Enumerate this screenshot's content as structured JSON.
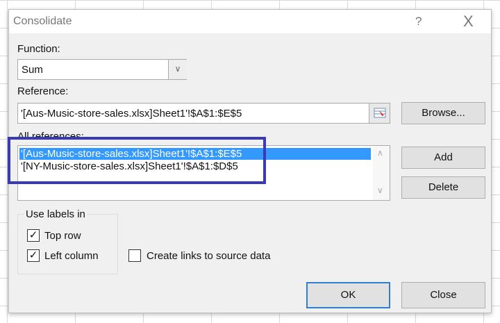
{
  "dialog": {
    "title": "Consolidate",
    "help": "?",
    "close": "X"
  },
  "function": {
    "label": "Function:",
    "value": "Sum"
  },
  "reference": {
    "label": "Reference:",
    "value": "'[Aus-Music-store-sales.xlsx]Sheet1'!$A$1:$E$5",
    "browse": "Browse..."
  },
  "all_references": {
    "label": "All references:",
    "items": [
      "'[Aus-Music-store-sales.xlsx]Sheet1'!$A$1:$E$5",
      "'[NY-Music-store-sales.xlsx]Sheet1'!$A$1:$D$5"
    ],
    "selected_index": 0
  },
  "buttons": {
    "add": "Add",
    "delete": "Delete",
    "ok": "OK",
    "close": "Close"
  },
  "labels_group": {
    "title": "Use labels in",
    "top_row": "Top row",
    "left_column": "Left column",
    "top_row_checked": true,
    "left_column_checked": true
  },
  "create_links": {
    "label": "Create links to source data",
    "checked": false
  },
  "colors": {
    "highlight_box": "#3a3ab8",
    "selection": "#3399ff",
    "ok_border": "#2f7fd0"
  }
}
